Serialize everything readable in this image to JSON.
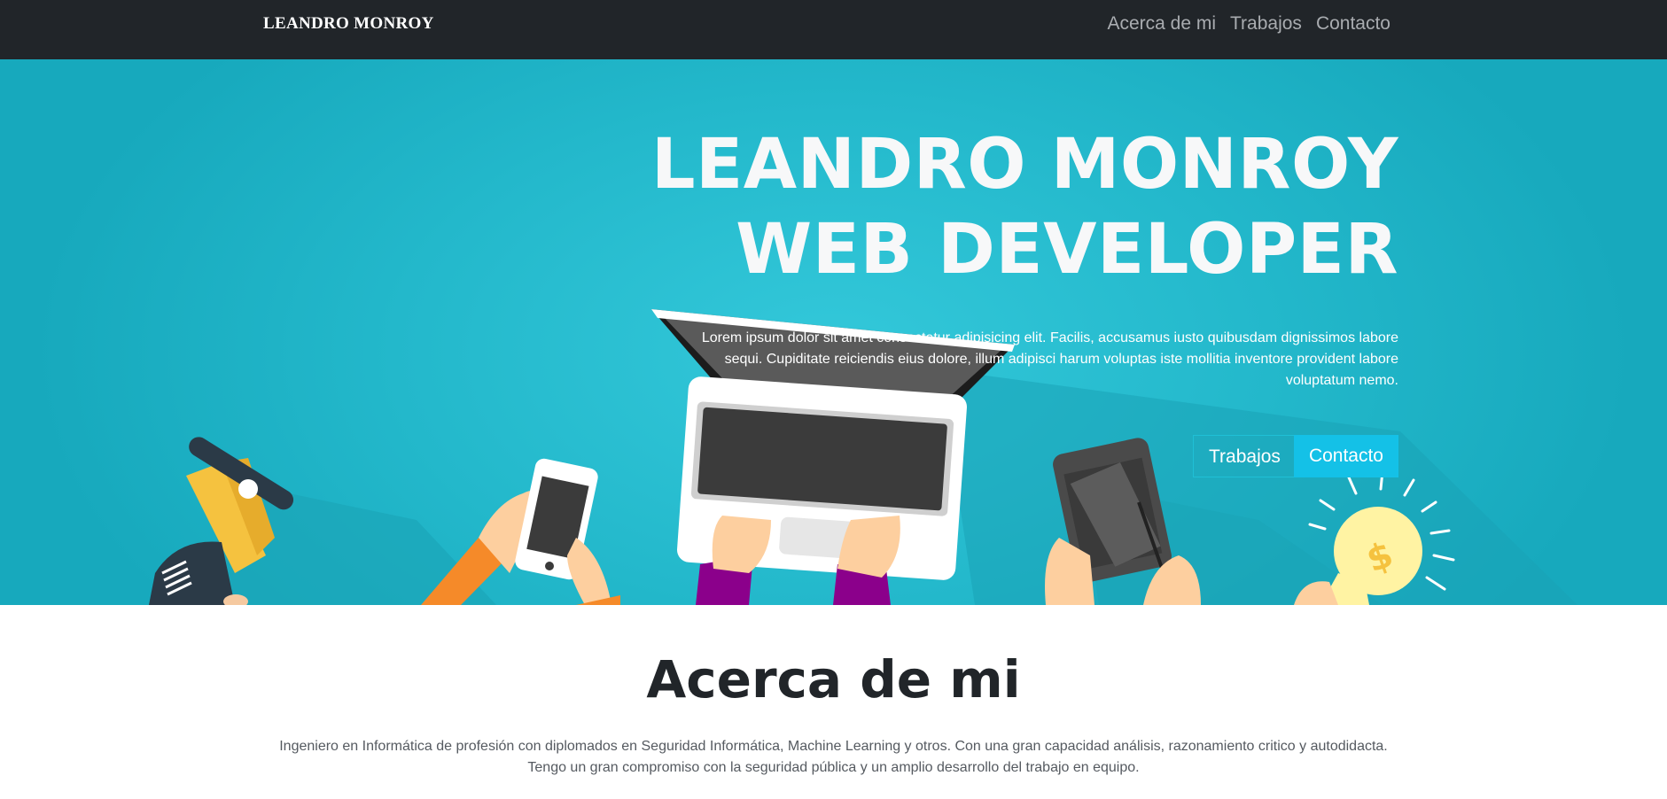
{
  "navbar": {
    "brand": "LEANDRO MONROY",
    "links": [
      {
        "label": "Acerca de mi"
      },
      {
        "label": "Trabajos"
      },
      {
        "label": "Contacto"
      }
    ]
  },
  "hero": {
    "title_line1": "LEANDRO MONROY",
    "title_line2": "WEB DEVELOPER",
    "text": "Lorem ipsum dolor sit amet consectetur adipisicing elit. Facilis, accusamus iusto quibusdam dignissimos labore sequi. Cupiditate reiciendis eius dolore, illum adipisci harum voluptas iste mollitia inventore provident labore voluptatum nemo.",
    "buttons": {
      "works": "Trabajos",
      "contact": "Contacto"
    }
  },
  "about": {
    "title": "Acerca de mi",
    "text_line1": "Ingeniero en Informática de profesión con diplomados en Seguridad Informática, Machine Learning y otros. Con una gran capacidad análisis, razonamiento critico y autodidacta.",
    "text_line2": "Tengo un gran compromiso con la seguridad pública y un amplio desarrollo del trabajo en equipo."
  },
  "colors": {
    "navbar_bg": "#212529",
    "hero_bg": "#23b8cb",
    "accent": "#14c1e7"
  },
  "icons": [
    "megaphone-icon",
    "smartphone-icon",
    "laptop-icon",
    "tablet-icon",
    "lightbulb-icon"
  ]
}
